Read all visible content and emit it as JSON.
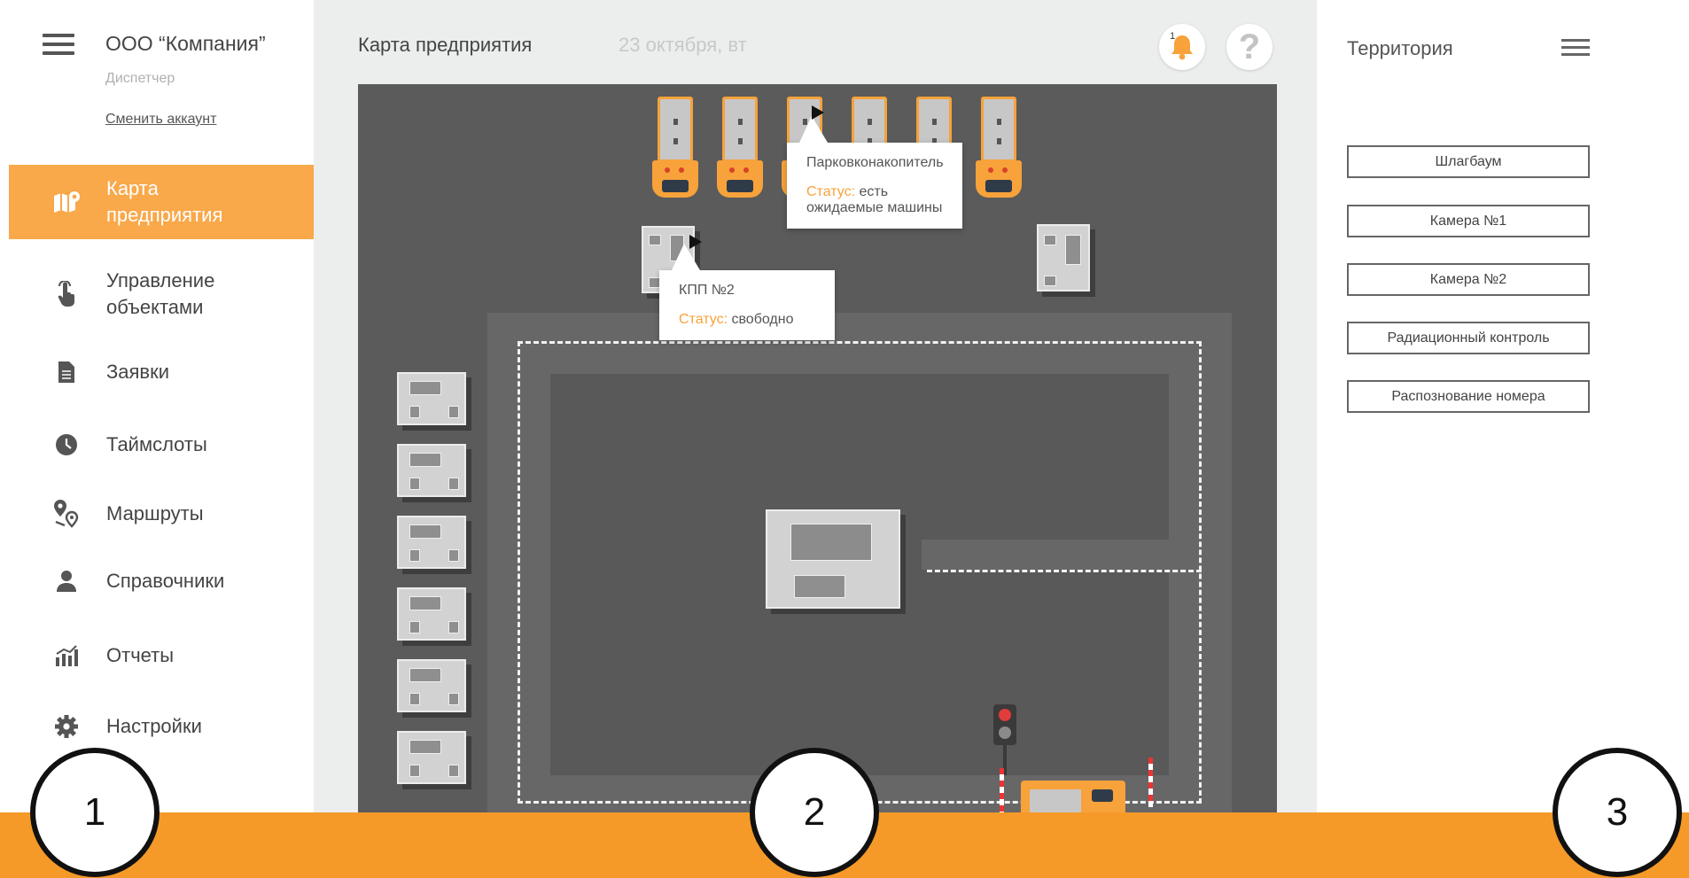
{
  "sidebar": {
    "company": "ООО “Компания”",
    "role": "Диспетчер",
    "switch_account": "Сменить аккаунт",
    "items": [
      {
        "label": "Карта предприятия",
        "icon": "map-icon",
        "active": true
      },
      {
        "label": "Управление объектами",
        "icon": "touch-icon",
        "active": false
      },
      {
        "label": "Заявки",
        "icon": "document-icon",
        "active": false
      },
      {
        "label": "Таймслоты",
        "icon": "clock-icon",
        "active": false
      },
      {
        "label": "Маршруты",
        "icon": "route-icon",
        "active": false
      },
      {
        "label": "Справочники",
        "icon": "user-icon",
        "active": false
      },
      {
        "label": "Отчеты",
        "icon": "chart-icon",
        "active": false
      },
      {
        "label": "Настройки",
        "icon": "gear-icon",
        "active": false
      }
    ]
  },
  "header": {
    "title": "Карта предприятия",
    "date": "23 октября, вт",
    "notification_count": "1"
  },
  "map": {
    "tooltips": [
      {
        "title": "Парковконакопитель",
        "status_label": "Статус:",
        "status_value": "есть ожидаемые машины"
      },
      {
        "title": "КПП №2",
        "status_label": "Статус:",
        "status_value": "свободно"
      }
    ]
  },
  "right_panel": {
    "title": "Территория",
    "buttons": [
      "Шлагбаум",
      "Камера №1",
      "Камера №2",
      "Радиационный контроль",
      "Распознование номера"
    ]
  },
  "callouts": [
    "1",
    "2",
    "3"
  ],
  "colors": {
    "accent": "#f9a84a",
    "band": "#f59a28",
    "map_bg": "#5b5b5b"
  }
}
